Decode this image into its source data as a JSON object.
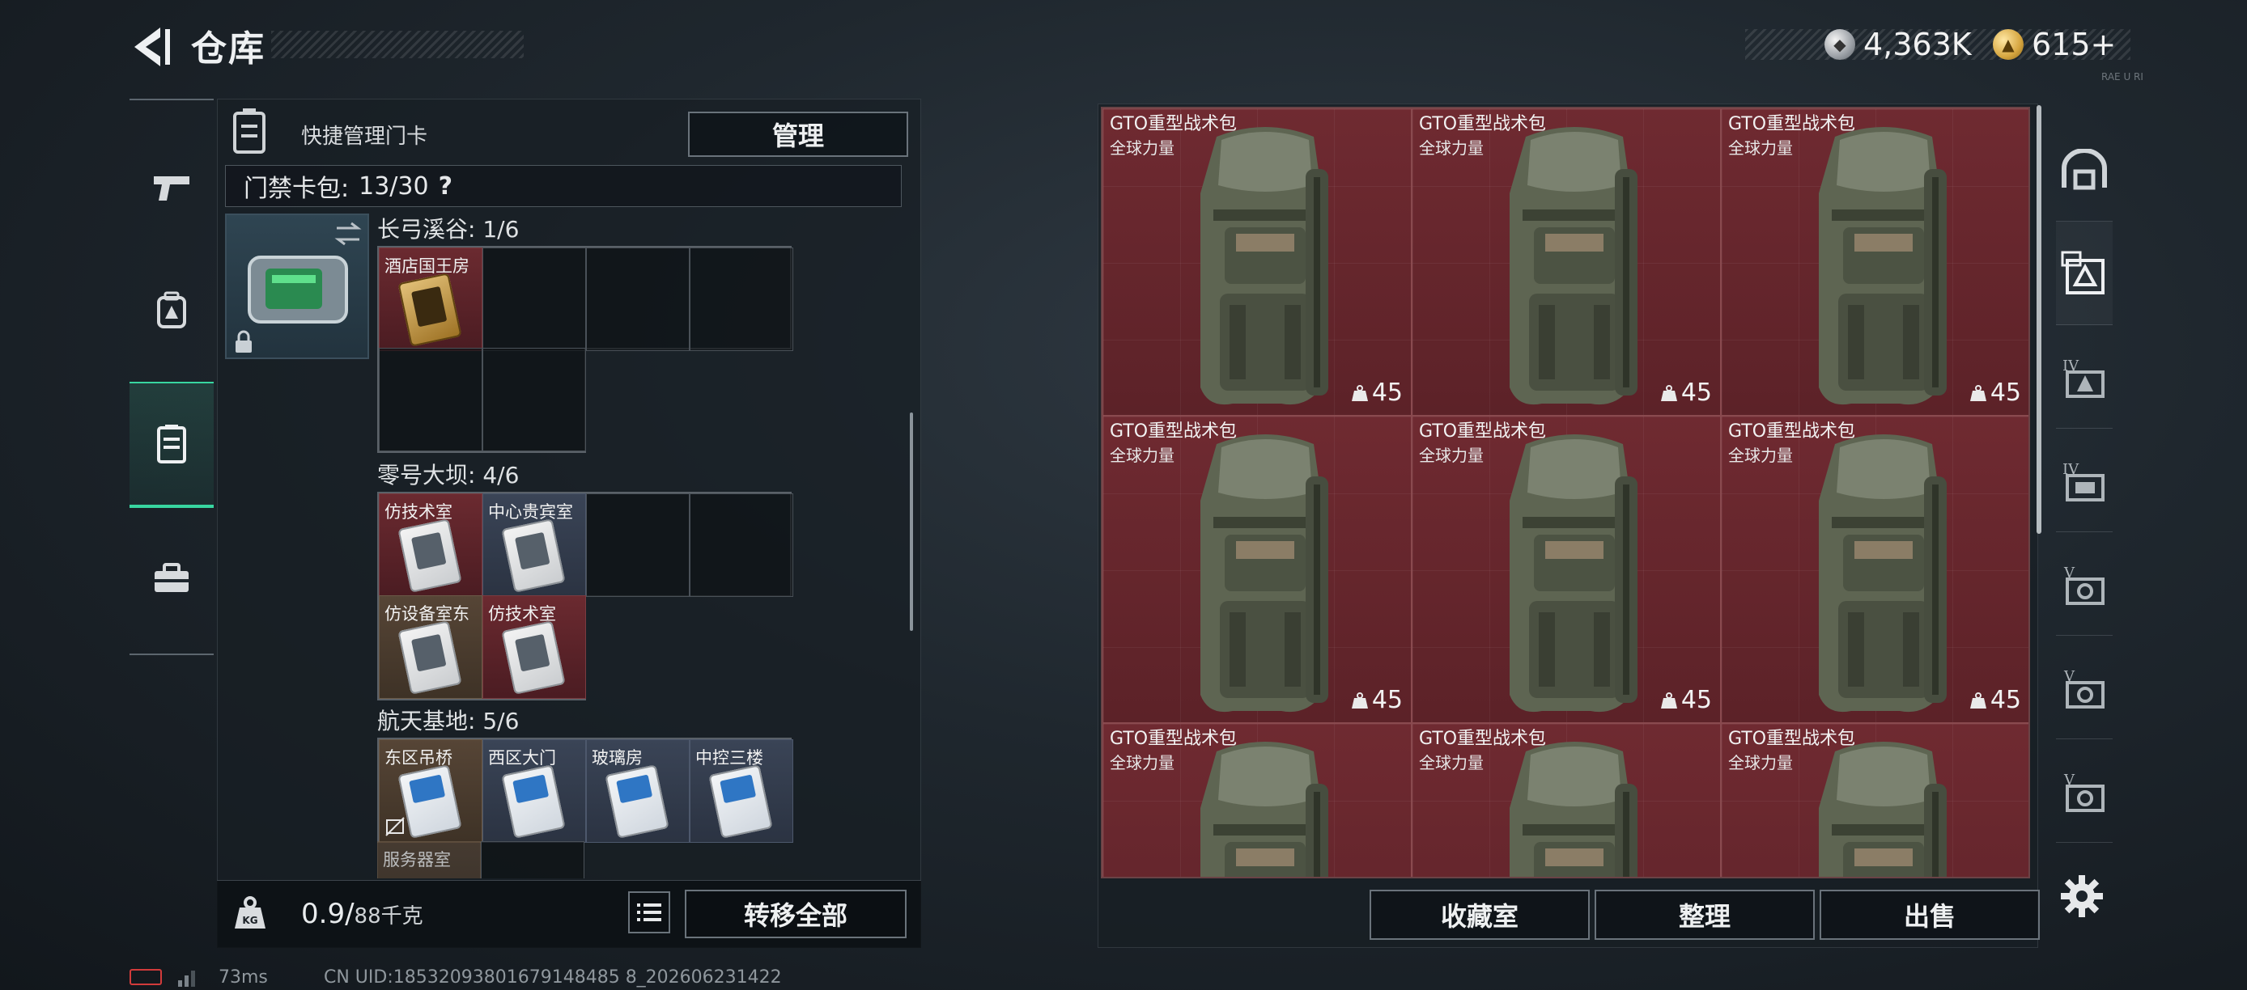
{
  "header": {
    "title": "仓库"
  },
  "currency": {
    "silver": "4,363K",
    "gold": "615+",
    "tiny_tag": "RAE U RI"
  },
  "left_panel": {
    "header_label": "快捷管理门卡",
    "manage_label": "管理",
    "pouch_label": "门禁卡包:",
    "pouch_count": "13/30",
    "pouch_help": "?",
    "maps": [
      {
        "name": "长弓溪谷: 1/6",
        "slots": [
          {
            "name": "酒店国王房",
            "color": "red",
            "card": "gold"
          }
        ]
      },
      {
        "name": "零号大坝: 4/6",
        "slots": [
          {
            "name": "仿技术室",
            "color": "red",
            "card": "white"
          },
          {
            "name": "中心贵宾室",
            "color": "navy",
            "card": "white"
          },
          {
            "name": "仿设备室东",
            "color": "brown",
            "card": "white"
          },
          {
            "name": "仿技术室",
            "color": "red",
            "card": "white"
          }
        ]
      },
      {
        "name": "航天基地: 5/6",
        "slots": [
          {
            "name": "东区吊桥",
            "color": "brown",
            "card": "blue"
          },
          {
            "name": "西区大门",
            "color": "navy",
            "card": "blue"
          },
          {
            "name": "玻璃房",
            "color": "navy",
            "card": "blue"
          },
          {
            "name": "中控三楼",
            "color": "navy",
            "card": "blue"
          },
          {
            "name": "服务器室",
            "color": "brown",
            "card": "blue"
          }
        ]
      }
    ],
    "weight_value": "0.9/",
    "weight_max": "88千克",
    "transfer_label": "转移全部"
  },
  "stash": {
    "item_name": "GTO重型战术包",
    "item_sub": "全球力量",
    "tiles": [
      {
        "count": "45"
      },
      {
        "count": "45"
      },
      {
        "count": "45"
      },
      {
        "count": "45"
      },
      {
        "count": "45"
      },
      {
        "count": "45"
      },
      {
        "count": ""
      },
      {
        "count": ""
      },
      {
        "count": ""
      }
    ],
    "buttons": {
      "collection": "收藏室",
      "sort": "整理",
      "sell": "出售"
    }
  },
  "right_nav": {
    "items": [
      "vault-icon",
      "key-card-icon",
      "tier-iv-icon",
      "tier-iv-box-icon",
      "tier-v-icon",
      "tier-v-icon",
      "tier-v-icon"
    ]
  },
  "footer": {
    "ping": "73ms",
    "uid": "CN UID:18532093801679148485 8_202606231422"
  },
  "colors": {
    "accent": "#38d6a0",
    "tile_red": "#6f2a31",
    "battery": "#d23b3b"
  }
}
